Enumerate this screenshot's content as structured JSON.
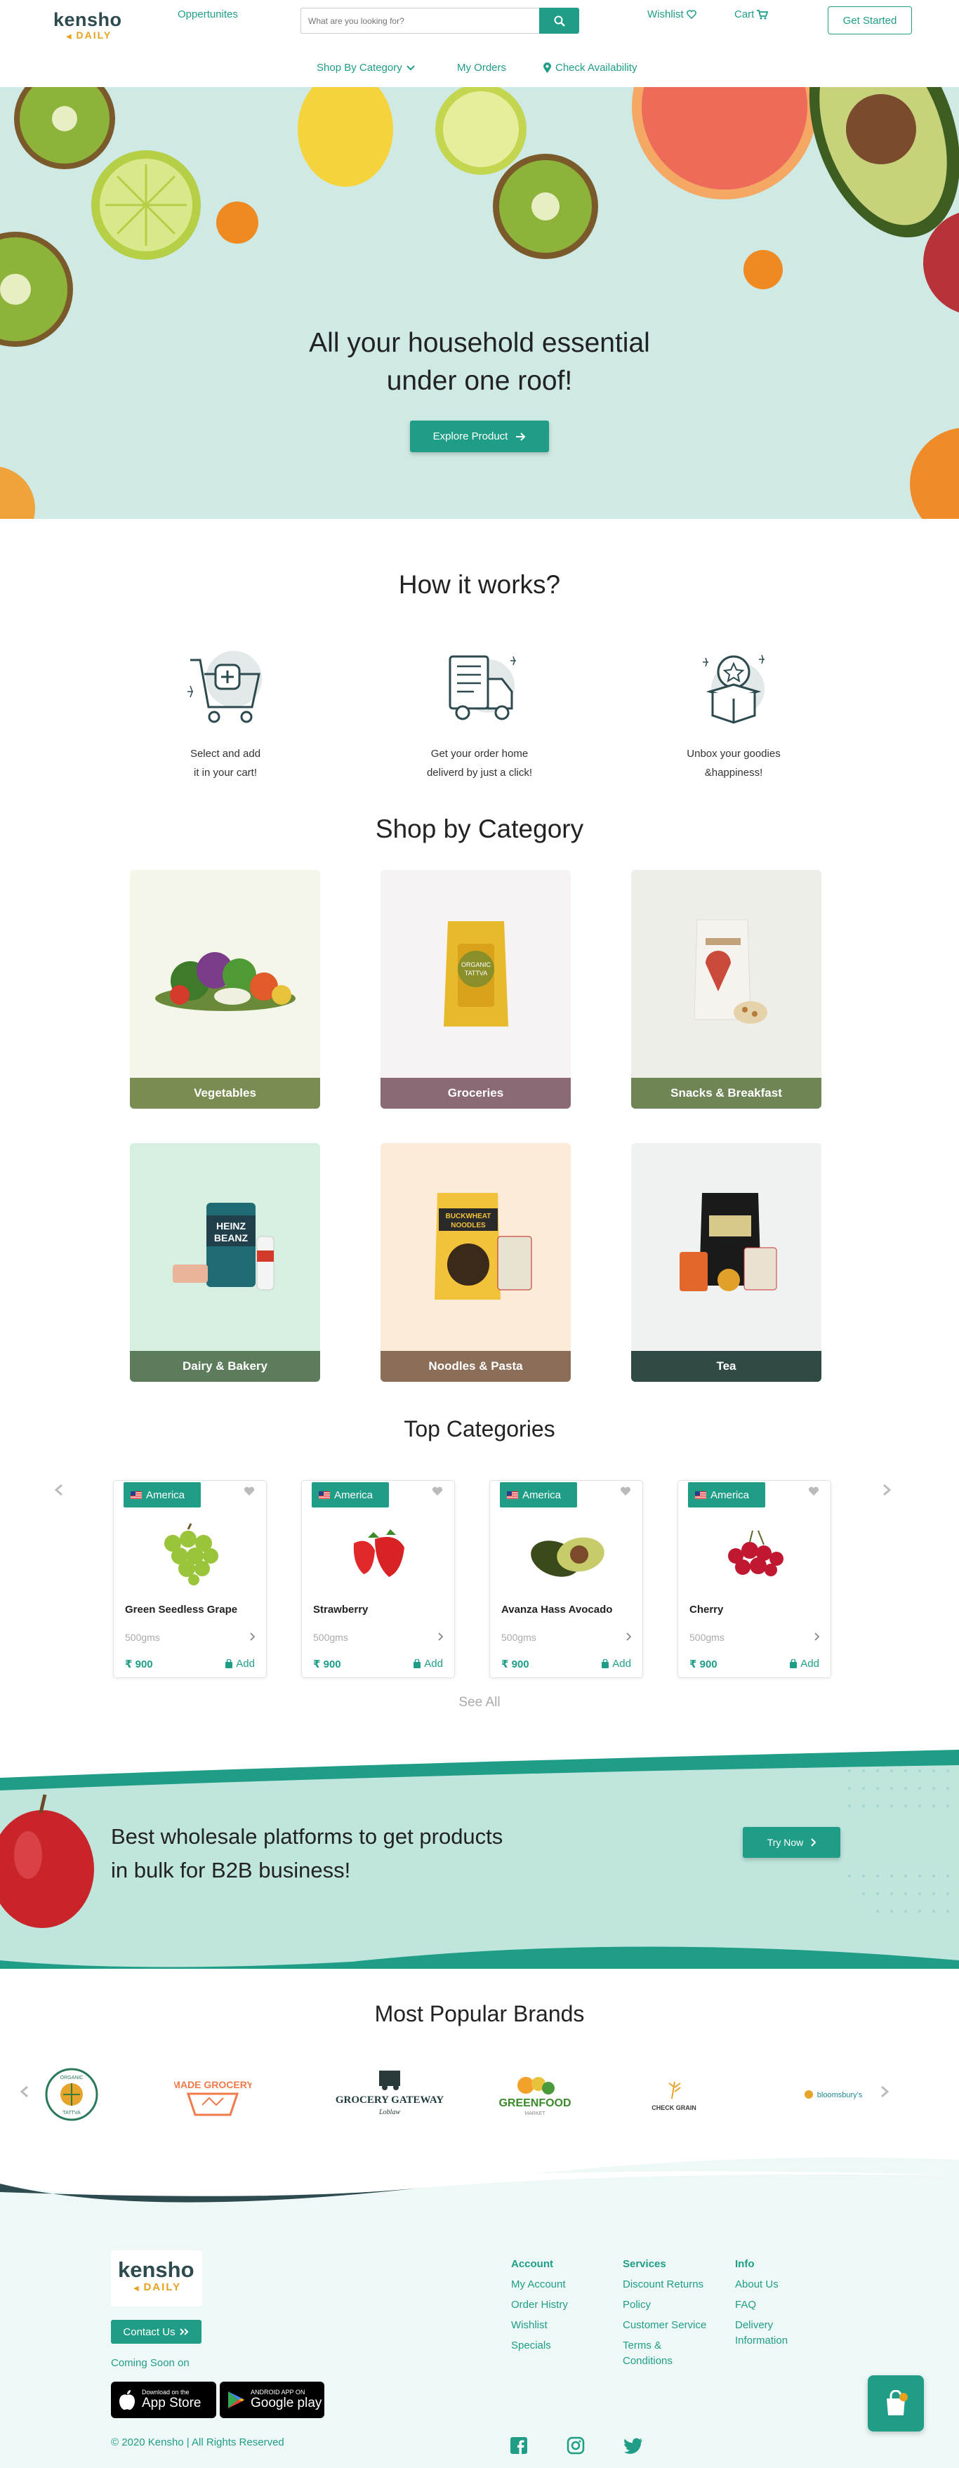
{
  "header": {
    "logo_top": "kensho",
    "logo_bottom": "DAILY",
    "opportunities": "Oppertunites",
    "search_placeholder": "What are you looking for?",
    "wishlist": "Wishlist",
    "cart": "Cart",
    "get_started": "Get Started"
  },
  "nav": {
    "shop_by_category": "Shop By Category",
    "my_orders": "My Orders",
    "check_availability": "Check Availability"
  },
  "hero": {
    "title_line1": "All your household essential",
    "title_line2": "under one roof!",
    "cta": "Explore Product",
    "bg_color": "#cfe9e4"
  },
  "how": {
    "title": "How it works?",
    "steps": [
      {
        "icon": "cart-plus-icon",
        "line1": "Select and add",
        "line2": "it in your cart!"
      },
      {
        "icon": "delivery-truck-icon",
        "line1": "Get your order home",
        "line2": "deliverd by just a click!"
      },
      {
        "icon": "gift-box-icon",
        "line1": "Unbox your goodies",
        "line2": "&happiness!"
      }
    ]
  },
  "categories": {
    "title": "Shop by Category",
    "items": [
      {
        "label": "Vegetables",
        "bar": "#7a8c52",
        "bg": "#f3f6e9"
      },
      {
        "label": "Groceries",
        "bar": "#8a6a74",
        "bg": "#f7f3f4"
      },
      {
        "label": "Snacks & Breakfast",
        "bar": "#6f8556",
        "bg": "#eeeee9"
      },
      {
        "label": "Dairy & Bakery",
        "bar": "#5c7c5c",
        "bg": "#d6efe1"
      },
      {
        "label": "Noodles & Pasta",
        "bar": "#8a6e58",
        "bg": "#fdebd9"
      },
      {
        "label": "Tea",
        "bar": "#2f4a44",
        "bg": "#eef3f2"
      }
    ]
  },
  "top_categories": {
    "title": "Top Categories",
    "see_all": "See All",
    "products": [
      {
        "origin": "America",
        "name": "Green Seedless Grape",
        "weight": "500gms",
        "price": "900",
        "add": "Add"
      },
      {
        "origin": "America",
        "name": "Strawberry",
        "weight": "500gms",
        "price": "900",
        "add": "Add"
      },
      {
        "origin": "America",
        "name": "Avanza Hass Avocado",
        "weight": "500gms",
        "price": "900",
        "add": "Add"
      },
      {
        "origin": "America",
        "name": "Cherry",
        "weight": "500gms",
        "price": "900",
        "add": "Add"
      }
    ]
  },
  "b2b": {
    "line1": "Best wholesale platforms to get products",
    "line2": "in bulk for B2B business!",
    "cta": "Try Now"
  },
  "brands": {
    "title": "Most Popular Brands",
    "logos": [
      {
        "text1": "ORGANIC",
        "text2": "TATTVA"
      },
      {
        "text1": "MADE",
        "text2": "GROCERY"
      },
      {
        "text1": "GROCERY GATEWAY",
        "text2": "Loblaw"
      },
      {
        "text1": "GREENFOOD",
        "text2": "MARKET"
      },
      {
        "text1": "CHECK GRAIN",
        "text2": ""
      },
      {
        "text1": "bloomsbury's",
        "text2": ""
      }
    ]
  },
  "footer": {
    "logo_top": "kensho",
    "logo_bottom": "DAILY",
    "contact": "Contact Us",
    "coming_soon": "Coming Soon on",
    "app_store_small": "Download on the",
    "app_store": "App Store",
    "google_small": "ANDROID APP ON",
    "google": "Google play",
    "copyright": "© 2020 Kensho | All Rights Reserved",
    "account": {
      "head": "Account",
      "items": [
        "My Account",
        "Order Histry",
        "Wishlist",
        "Specials"
      ]
    },
    "services": {
      "head": "Services",
      "items": [
        "Discount Returns",
        "Policy",
        "Customer Service",
        "Terms &",
        "Conditions"
      ]
    },
    "info": {
      "head": "Info",
      "items": [
        "About Us",
        "FAQ",
        "Delivery",
        "Information"
      ]
    }
  },
  "colors": {
    "accent": "#1f9d87",
    "dark": "#2d4a4f",
    "orange": "#e8a020"
  }
}
